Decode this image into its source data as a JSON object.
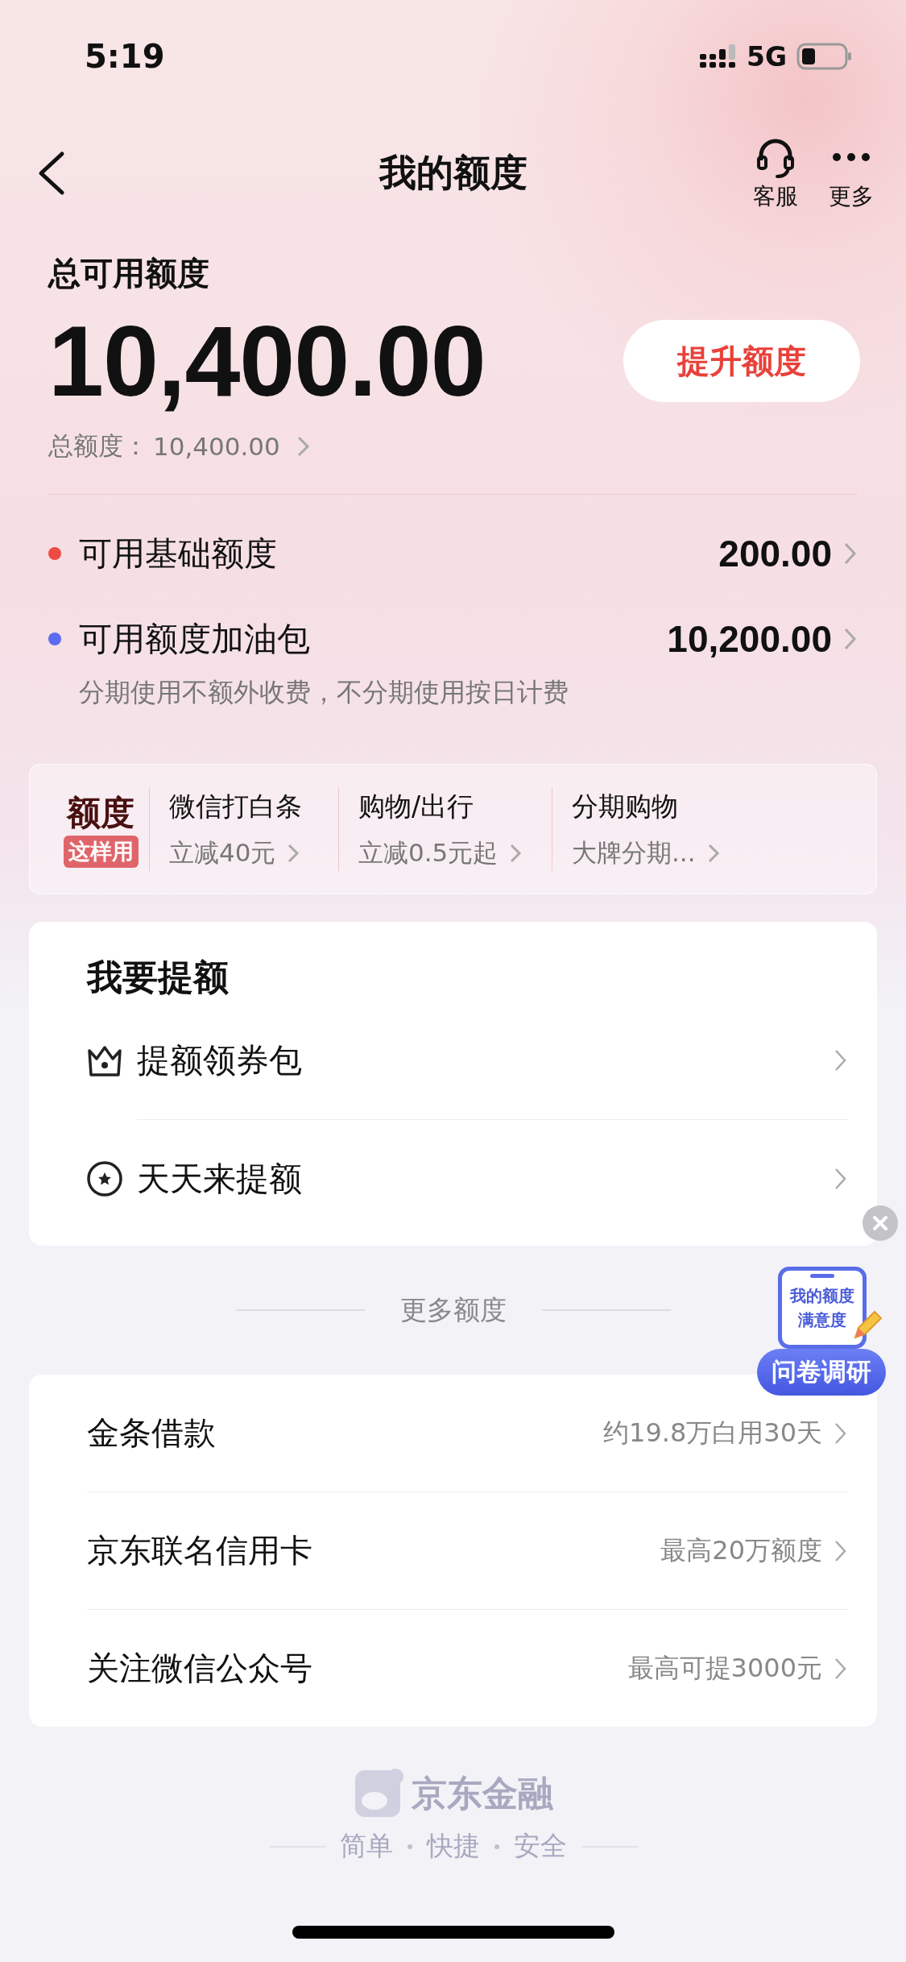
{
  "status_bar": {
    "time": "5:19",
    "network": "5G"
  },
  "nav": {
    "title": "我的额度",
    "actions": [
      {
        "kind": "headset",
        "label": "客服"
      },
      {
        "kind": "more",
        "label": "更多"
      }
    ]
  },
  "summary": {
    "label": "总可用额度",
    "amount": "10,400.00",
    "button": "提升额度",
    "total_label": "总额度：",
    "total_value": "10,400.00"
  },
  "breakdown": [
    {
      "name": "可用基础额度",
      "color": "#ee4b45",
      "value": "200.00"
    },
    {
      "name": "可用额度加油包",
      "color": "#5b6cf0",
      "value": "10,200.00"
    }
  ],
  "breakdown_note": "分期使用不额外收费，不分期使用按日计费",
  "promo": {
    "badge_title": "额度",
    "badge_tag": "这样用",
    "items": [
      {
        "title": "微信打白条",
        "subtitle": "立减40元"
      },
      {
        "title": "购物/出行",
        "subtitle": "立减0.5元起"
      },
      {
        "title": "分期购物",
        "subtitle": "大牌分期..."
      }
    ]
  },
  "boost": {
    "title": "我要提额",
    "items": [
      {
        "kind": "crown",
        "label": "提额领券包"
      },
      {
        "kind": "star",
        "label": "天天来提额"
      }
    ]
  },
  "more_title": "更多额度",
  "more_items": [
    {
      "label": "金条借款",
      "hint": "约19.8万白用30天"
    },
    {
      "label": "京东联名信用卡",
      "hint": "最高20万额度"
    },
    {
      "label": "关注微信公众号",
      "hint": "最高可提3000元"
    }
  ],
  "survey": {
    "lines": [
      "我的额度",
      "满意度"
    ],
    "button": "问卷调研"
  },
  "footer": {
    "brand": "京东金融",
    "slogan": [
      "简单",
      "快捷",
      "安全"
    ]
  }
}
